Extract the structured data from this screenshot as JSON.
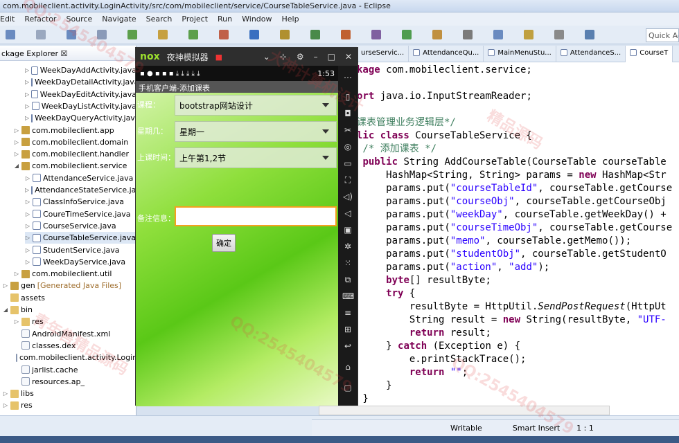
{
  "window": {
    "title": "com.mobileclient.activity.LoginActivity/src/com/mobileclient/service/CourseTableService.java - Eclipse"
  },
  "menu": [
    "Edit",
    "Refactor",
    "Source",
    "Navigate",
    "Search",
    "Project",
    "Run",
    "Window",
    "Help"
  ],
  "quick_access": "Quick Ac",
  "package_explorer": {
    "tab_label": "ckage Explorer ☒",
    "rows": [
      {
        "label": "WeekDayAddActivity.java"
      },
      {
        "label": "WeekDayDetailActivity.java"
      },
      {
        "label": "WeekDayEditActivity.java"
      },
      {
        "label": "WeekDayListActivity.java"
      },
      {
        "label": "WeekDayQueryActivity.java"
      },
      {
        "label": "com.mobileclient.app"
      },
      {
        "label": "com.mobileclient.domain"
      },
      {
        "label": "com.mobileclient.handler"
      },
      {
        "label": "com.mobileclient.service"
      },
      {
        "label": "AttendanceService.java"
      },
      {
        "label": "AttendanceStateService.java"
      },
      {
        "label": "ClassInfoService.java"
      },
      {
        "label": "CoureTimeService.java"
      },
      {
        "label": "CourseService.java"
      },
      {
        "label": "CourseTableService.java"
      },
      {
        "label": "StudentService.java"
      },
      {
        "label": "WeekDayService.java"
      },
      {
        "label": "com.mobileclient.util"
      },
      {
        "label": "gen",
        "note": "[Generated Java Files]"
      },
      {
        "label": "assets"
      },
      {
        "label": "bin"
      },
      {
        "label": "res"
      },
      {
        "label": "AndroidManifest.xml"
      },
      {
        "label": "classes.dex"
      },
      {
        "label": "com.mobileclient.activity.Login"
      },
      {
        "label": "jarlist.cache"
      },
      {
        "label": "resources.ap_"
      },
      {
        "label": "libs"
      },
      {
        "label": "res"
      }
    ]
  },
  "editor": {
    "tabs": [
      "urseServic...",
      "AttendanceQu...",
      "MainMenuStu...",
      "AttendanceS...",
      "CourseT"
    ],
    "code": [
      [
        {
          "k": "kw",
          "t": "kage"
        },
        {
          "t": " com.mobileclient.service;"
        }
      ],
      [
        {
          "t": ""
        }
      ],
      [
        {
          "k": "kw",
          "t": "ort"
        },
        {
          "t": " java.io.InputStreamReader;"
        }
      ],
      [
        {
          "t": ""
        }
      ],
      [
        {
          "k": "cm",
          "t": "课表管理业务逻辑层*/"
        }
      ],
      [
        {
          "k": "kw",
          "t": "lic class"
        },
        {
          "t": " CourseTableService {"
        }
      ],
      [
        {
          "k": "cm",
          "t": " /* 添加课表 */"
        }
      ],
      [
        {
          "t": " "
        },
        {
          "k": "kw",
          "t": "public"
        },
        {
          "t": " String AddCourseTable(CourseTable courseTable"
        }
      ],
      [
        {
          "t": "     HashMap<String, String> params = "
        },
        {
          "k": "kw",
          "t": "new"
        },
        {
          "t": " HashMap<Str"
        }
      ],
      [
        {
          "t": "     params.put("
        },
        {
          "k": "str",
          "t": "\"courseTableId\""
        },
        {
          "t": ", courseTable.getCourse"
        }
      ],
      [
        {
          "t": "     params.put("
        },
        {
          "k": "str",
          "t": "\"courseObj\""
        },
        {
          "t": ", courseTable.getCourseObj"
        }
      ],
      [
        {
          "t": "     params.put("
        },
        {
          "k": "str",
          "t": "\"weekDay\""
        },
        {
          "t": ", courseTable.getWeekDay() +"
        }
      ],
      [
        {
          "t": "     params.put("
        },
        {
          "k": "str",
          "t": "\"courseTimeObj\""
        },
        {
          "t": ", courseTable.getCourse"
        }
      ],
      [
        {
          "t": "     params.put("
        },
        {
          "k": "str",
          "t": "\"memo\""
        },
        {
          "t": ", courseTable.getMemo());"
        }
      ],
      [
        {
          "t": "     params.put("
        },
        {
          "k": "str",
          "t": "\"studentObj\""
        },
        {
          "t": ", courseTable.getStudentO"
        }
      ],
      [
        {
          "t": "     params.put("
        },
        {
          "k": "str",
          "t": "\"action\""
        },
        {
          "t": ", "
        },
        {
          "k": "str",
          "t": "\"add\""
        },
        {
          "t": ");"
        }
      ],
      [
        {
          "t": "     "
        },
        {
          "k": "kw",
          "t": "byte"
        },
        {
          "t": "[] resultByte;"
        }
      ],
      [
        {
          "t": "     "
        },
        {
          "k": "kw",
          "t": "try"
        },
        {
          "t": " {"
        }
      ],
      [
        {
          "t": "         resultByte = HttpUtil."
        },
        {
          "k": "it",
          "t": "SendPostRequest"
        },
        {
          "t": "(HttpUt"
        }
      ],
      [
        {
          "t": "         String result = "
        },
        {
          "k": "kw",
          "t": "new"
        },
        {
          "t": " String(resultByte, "
        },
        {
          "k": "str",
          "t": "\"UTF-"
        }
      ],
      [
        {
          "t": "         "
        },
        {
          "k": "kw",
          "t": "return"
        },
        {
          "t": " result;"
        }
      ],
      [
        {
          "t": "     } "
        },
        {
          "k": "kw",
          "t": "catch"
        },
        {
          "t": " (Exception e) {"
        }
      ],
      [
        {
          "t": "         e.printStackTrace();"
        }
      ],
      [
        {
          "t": "         "
        },
        {
          "k": "kw",
          "t": "return"
        },
        {
          "t": " "
        },
        {
          "k": "str",
          "t": "\"\""
        },
        {
          "t": ";"
        }
      ],
      [
        {
          "t": "     }"
        }
      ],
      [
        {
          "t": " }"
        }
      ]
    ]
  },
  "emulator": {
    "logo": "nox",
    "title": "夜神模拟器",
    "time": "1:53",
    "app_title": "手机客户端-添加课表",
    "form": {
      "course_label": "课程：",
      "course_value": "bootstrap网站设计",
      "weekday_label": "星期几：",
      "weekday_value": "星期一",
      "time_label": "上课时间：",
      "time_value": "上午第1,2节",
      "memo_label": "备注信息：",
      "memo_value": "",
      "ok_label": "确定"
    }
  },
  "statusbar": {
    "writable": "Writable",
    "insert": "Smart Insert",
    "position": "1 : 1"
  },
  "watermarks": [
    "QQ:2545404579",
    "大神计算机设计",
    "精品源码",
    "青年售精品源码",
    "QQ:2545404579",
    "QQ:2545404579"
  ]
}
